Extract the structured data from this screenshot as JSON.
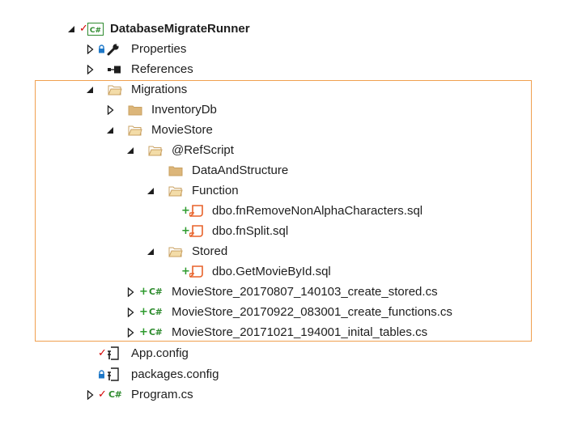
{
  "tree": {
    "project": {
      "label": "DatabaseMigrateRunner",
      "icon": "csharp-project-icon",
      "status": "checked-in"
    },
    "properties": {
      "label": "Properties",
      "icon": "wrench-icon"
    },
    "references": {
      "label": "References",
      "icon": "references-icon"
    },
    "migrations": {
      "label": "Migrations",
      "icon": "folder-open-icon"
    },
    "inventorydb": {
      "label": "InventoryDb",
      "icon": "folder-icon"
    },
    "moviestore": {
      "label": "MovieStore",
      "icon": "folder-open-icon"
    },
    "refscript": {
      "label": "@RefScript",
      "icon": "folder-open-icon"
    },
    "dataandstructure": {
      "label": "DataAndStructure",
      "icon": "folder-icon"
    },
    "function": {
      "label": "Function",
      "icon": "folder-open-icon"
    },
    "fn_remove": {
      "label": "dbo.fnRemoveNonAlphaCharacters.sql",
      "icon": "sql-script-icon",
      "status": "added"
    },
    "fn_split": {
      "label": "dbo.fnSplit.sql",
      "icon": "sql-script-icon",
      "status": "added"
    },
    "stored": {
      "label": "Stored",
      "icon": "folder-open-icon"
    },
    "get_movie": {
      "label": "dbo.GetMovieById.sql",
      "icon": "sql-script-icon",
      "status": "added"
    },
    "ms_stored": {
      "label": "MovieStore_20170807_140103_create_stored.cs",
      "icon": "csharp-file-icon",
      "status": "added"
    },
    "ms_functions": {
      "label": "MovieStore_20170922_083001_create_functions.cs",
      "icon": "csharp-file-icon",
      "status": "added"
    },
    "ms_tables": {
      "label": "MovieStore_20171021_194001_inital_tables.cs",
      "icon": "csharp-file-icon",
      "status": "added"
    },
    "app_config": {
      "label": "App.config",
      "icon": "config-file-icon",
      "status": "checked-in"
    },
    "packages_config": {
      "label": "packages.config",
      "icon": "config-file-icon",
      "status": "locked"
    },
    "program_cs": {
      "label": "Program.cs",
      "icon": "csharp-file-icon",
      "status": "checked-in"
    }
  },
  "glyphs": {
    "csharp": "C#",
    "added": "+",
    "checked": "✓"
  },
  "colors": {
    "highlight_border": "#f0a050",
    "folder": "#dcb67a",
    "sql_icon": "#e8622a",
    "csharp_green": "#2e8b2e",
    "check_red": "#d40000",
    "lock_blue": "#1e78c8"
  }
}
